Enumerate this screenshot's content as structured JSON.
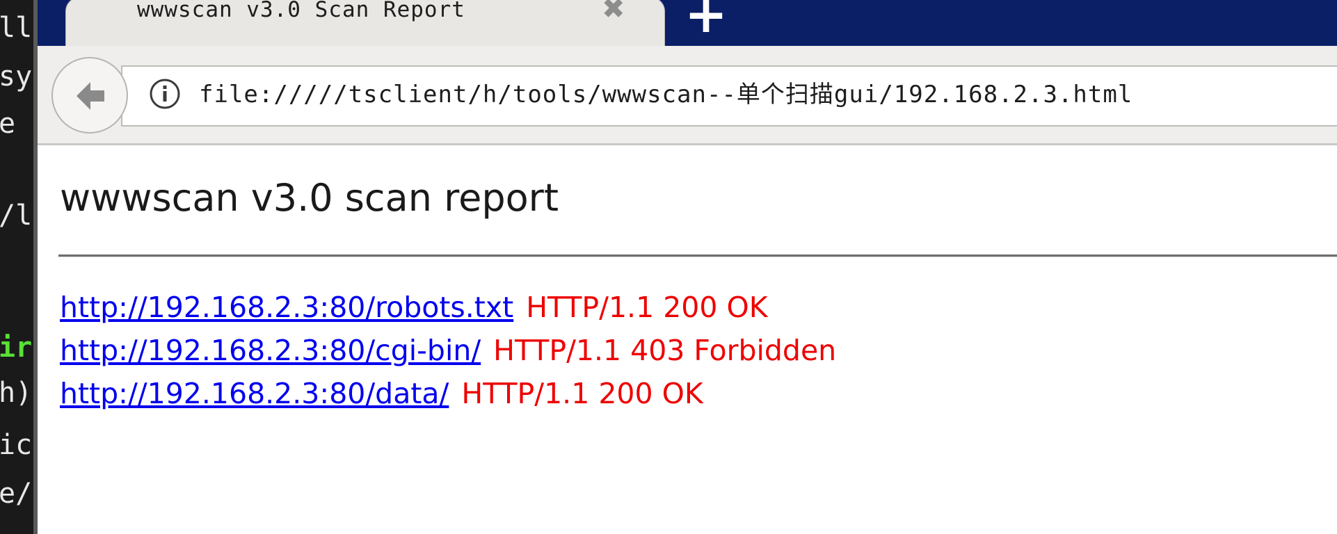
{
  "terminal": {
    "lines": [
      "ll",
      "sy",
      "e",
      "",
      "/l",
      "",
      "",
      "ir",
      "h)",
      "ic",
      "e/"
    ]
  },
  "tab": {
    "title": "wwwscan v3.0 Scan Report",
    "close_glyph": "✖",
    "new_tab_glyph": "+"
  },
  "address_bar": {
    "url": "file://///tsclient/h/tools/wwwscan--单个扫描gui/192.168.2.3.html"
  },
  "page": {
    "title": "wwwscan v3.0 scan report",
    "results": [
      {
        "url": "http://192.168.2.3:80/robots.txt",
        "status": "HTTP/1.1 200 OK"
      },
      {
        "url": "http://192.168.2.3:80/cgi-bin/",
        "status": "HTTP/1.1 403 Forbidden"
      },
      {
        "url": "http://192.168.2.3:80/data/",
        "status": "HTTP/1.1 200 OK"
      }
    ]
  },
  "colors": {
    "tabstrip": "#0b1f66",
    "link": "#0000ee",
    "status": "#ee0000"
  }
}
